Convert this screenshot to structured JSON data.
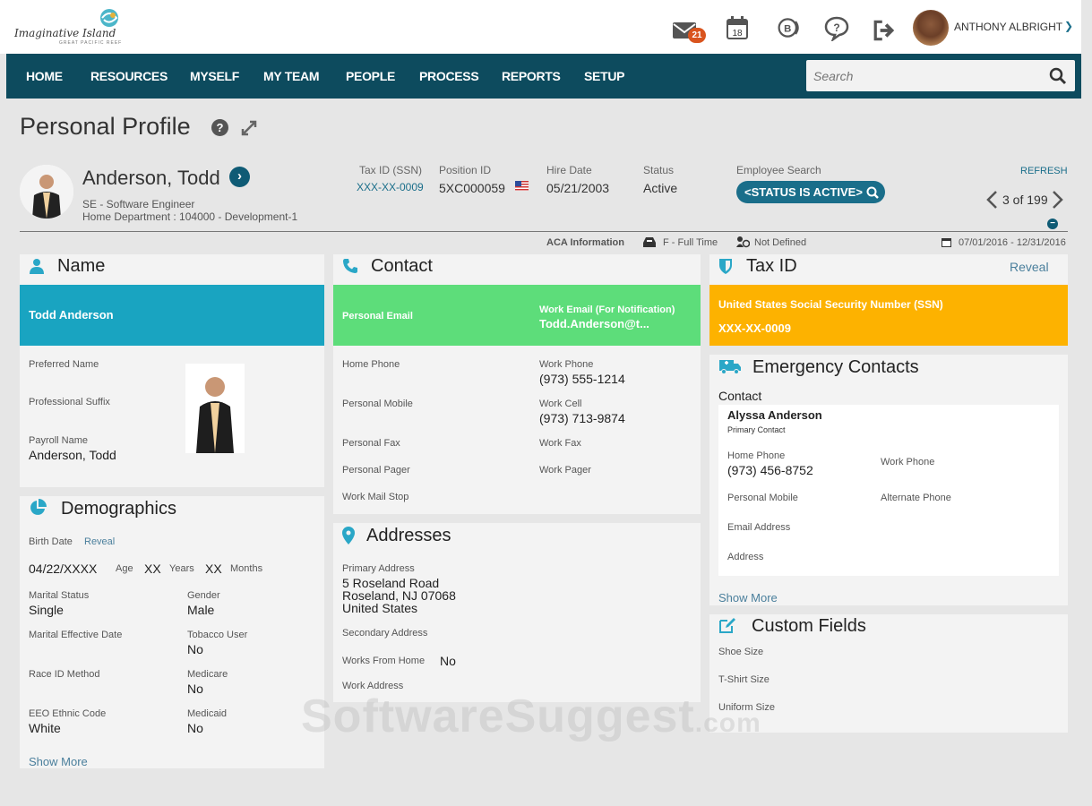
{
  "logo": {
    "text": "Imaginative Island",
    "sub": "GREAT PACIFIC REEF"
  },
  "header": {
    "mail_count": "21",
    "calendar_day": "18",
    "user_name": "ANTHONY ALBRIGHT"
  },
  "nav": {
    "items": [
      "HOME",
      "RESOURCES",
      "MYSELF",
      "MY TEAM",
      "PEOPLE",
      "PROCESS",
      "REPORTS",
      "SETUP"
    ],
    "search_placeholder": "Search"
  },
  "page": {
    "title": "Personal Profile"
  },
  "employee": {
    "name": "Anderson, Todd",
    "job": "SE - Software Engineer",
    "department": "Home Department : 104000 - Development-1",
    "tax_id_label": "Tax ID (SSN)",
    "tax_id": "XXX-XX-0009",
    "position_label": "Position ID",
    "position": "5XC000059",
    "hire_label": "Hire Date",
    "hire": "05/21/2003",
    "status_label": "Status",
    "status": "Active",
    "search_label": "Employee Search",
    "search_filter": "<STATUS IS ACTIVE>",
    "refresh": "REFRESH",
    "pager": "3 of 199"
  },
  "aca": {
    "label": "ACA Information",
    "time": "F - Full Time",
    "defined": "Not Defined",
    "range": "07/01/2016 - 12/31/2016"
  },
  "name_panel": {
    "title": "Name",
    "banner": "Todd Anderson",
    "preferred_label": "Preferred Name",
    "suffix_label": "Professional Suffix",
    "payroll_label": "Payroll Name",
    "payroll": "Anderson, Todd"
  },
  "demo_panel": {
    "title": "Demographics",
    "birth_label": "Birth Date",
    "reveal": "Reveal",
    "birth": "04/22/XXXX",
    "age_label": "Age",
    "age_years": "XX",
    "years_label": "Years",
    "age_months": "XX",
    "months_label": "Months",
    "marital_label": "Marital Status",
    "marital": "Single",
    "gender_label": "Gender",
    "gender": "Male",
    "marital_eff_label": "Marital Effective Date",
    "tobacco_label": "Tobacco User",
    "tobacco": "No",
    "race_label": "Race ID Method",
    "medicare_label": "Medicare",
    "medicare": "No",
    "eeo_label": "EEO Ethnic Code",
    "eeo": "White",
    "medicaid_label": "Medicaid",
    "medicaid": "No",
    "show_more": "Show More"
  },
  "contact_panel": {
    "title": "Contact",
    "personal_email_label": "Personal Email",
    "work_email_label": "Work Email (For Notification)",
    "work_email": "Todd.Anderson@t...",
    "home_phone_label": "Home Phone",
    "work_phone_label": "Work Phone",
    "work_phone": "(973) 555-1214",
    "personal_mobile_label": "Personal Mobile",
    "work_cell_label": "Work Cell",
    "work_cell": "(973) 713-9874",
    "personal_fax_label": "Personal Fax",
    "work_fax_label": "Work Fax",
    "personal_pager_label": "Personal Pager",
    "work_pager_label": "Work Pager",
    "mail_stop_label": "Work Mail Stop"
  },
  "address_panel": {
    "title": "Addresses",
    "primary_label": "Primary Address",
    "line1": "5 Roseland Road",
    "line2": "Roseland, NJ 07068",
    "line3": "United States",
    "secondary_label": "Secondary Address",
    "wfh_label": "Works From Home",
    "wfh": "No",
    "work_label": "Work Address"
  },
  "tax_panel": {
    "title": "Tax ID",
    "reveal": "Reveal",
    "banner_label": "United States Social Security Number (SSN)",
    "banner_value": "XXX-XX-0009"
  },
  "emergency_panel": {
    "title": "Emergency Contacts",
    "contact_label": "Contact",
    "name": "Alyssa Anderson",
    "role": "Primary Contact",
    "home_phone_label": "Home Phone",
    "home_phone": "(973) 456-8752",
    "work_phone_label": "Work Phone",
    "mobile_label": "Personal Mobile",
    "alt_phone_label": "Alternate Phone",
    "email_label": "Email Address",
    "address_label": "Address",
    "show_more": "Show More"
  },
  "custom_panel": {
    "title": "Custom Fields",
    "shoe_label": "Shoe Size",
    "shirt_label": "T-Shirt Size",
    "uniform_label": "Uniform Size"
  },
  "watermark": {
    "main": "SoftwareSuggest",
    "tld": ".com"
  },
  "colors": {
    "nav": "#0d4b5e",
    "name_banner": "#19a4c1",
    "contact_banner": "#5ddd7a",
    "tax_banner": "#fdb200",
    "link": "#4a7f9c"
  }
}
